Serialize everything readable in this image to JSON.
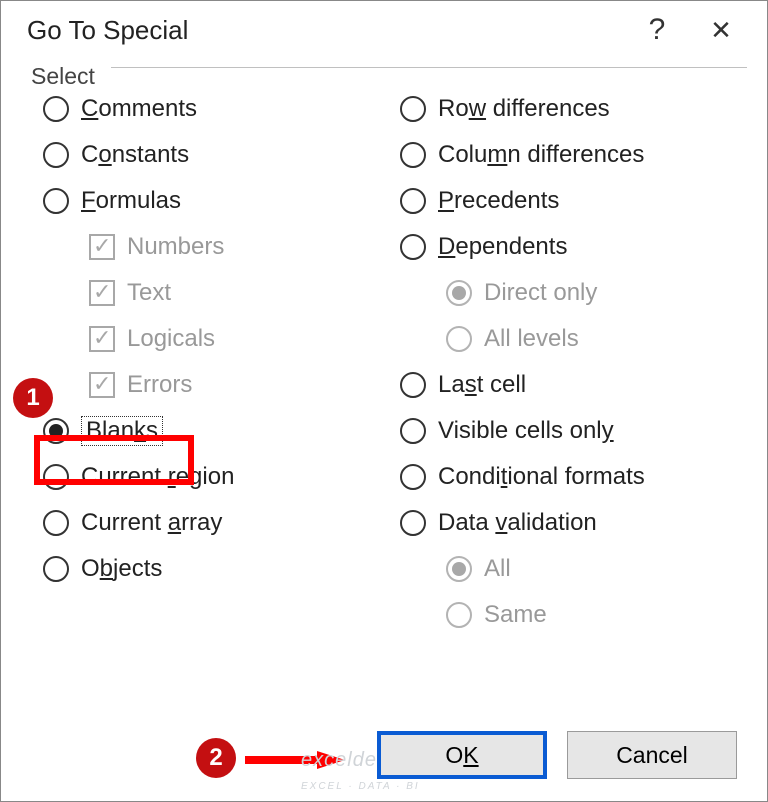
{
  "dialog": {
    "title": "Go To Special",
    "group_label": "Select"
  },
  "left": {
    "comments": {
      "label_pre": "",
      "accel": "C",
      "label_post": "omments"
    },
    "constants": {
      "label_pre": "C",
      "accel": "o",
      "label_post": "nstants"
    },
    "formulas": {
      "label_pre": "",
      "accel": "F",
      "label_post": "ormulas"
    },
    "numbers": "Numbers",
    "text": "Text",
    "logicals": "Logicals",
    "errors": "Errors",
    "blanks": {
      "label_pre": "Blan",
      "accel": "k",
      "label_post": "s"
    },
    "region": {
      "label_pre": "Current ",
      "accel": "r",
      "label_post": "egion"
    },
    "array": {
      "label_pre": "Current ",
      "accel": "a",
      "label_post": "rray"
    },
    "objects": {
      "label_pre": "O",
      "accel": "b",
      "label_post": "jects"
    }
  },
  "right": {
    "rowdiff": {
      "label_pre": "Ro",
      "accel": "w",
      "label_post": " differences"
    },
    "coldiff": {
      "label_pre": "Colu",
      "accel": "m",
      "label_post": "n differences"
    },
    "precedents": {
      "label_pre": "",
      "accel": "P",
      "label_post": "recedents"
    },
    "dependents": {
      "label_pre": "",
      "accel": "D",
      "label_post": "ependents"
    },
    "direct": "Direct only",
    "alllevels": "All levels",
    "lastcell": {
      "label_pre": "La",
      "accel": "s",
      "label_post": "t cell"
    },
    "visible": {
      "label_pre": "Visible cells onl",
      "accel": "y",
      "label_post": ""
    },
    "condfmt": {
      "label_pre": "Condi",
      "accel": "t",
      "label_post": "ional formats"
    },
    "validation": {
      "label_pre": "Data ",
      "accel": "v",
      "label_post": "alidation"
    },
    "all": "All",
    "same": "Same"
  },
  "buttons": {
    "ok": {
      "label_pre": "O",
      "accel": "K",
      "label_post": ""
    },
    "cancel": "Cancel"
  },
  "callouts": {
    "one": "1",
    "two": "2"
  },
  "watermark": {
    "brand": "exceldemy",
    "tag": "EXCEL · DATA · BI"
  }
}
